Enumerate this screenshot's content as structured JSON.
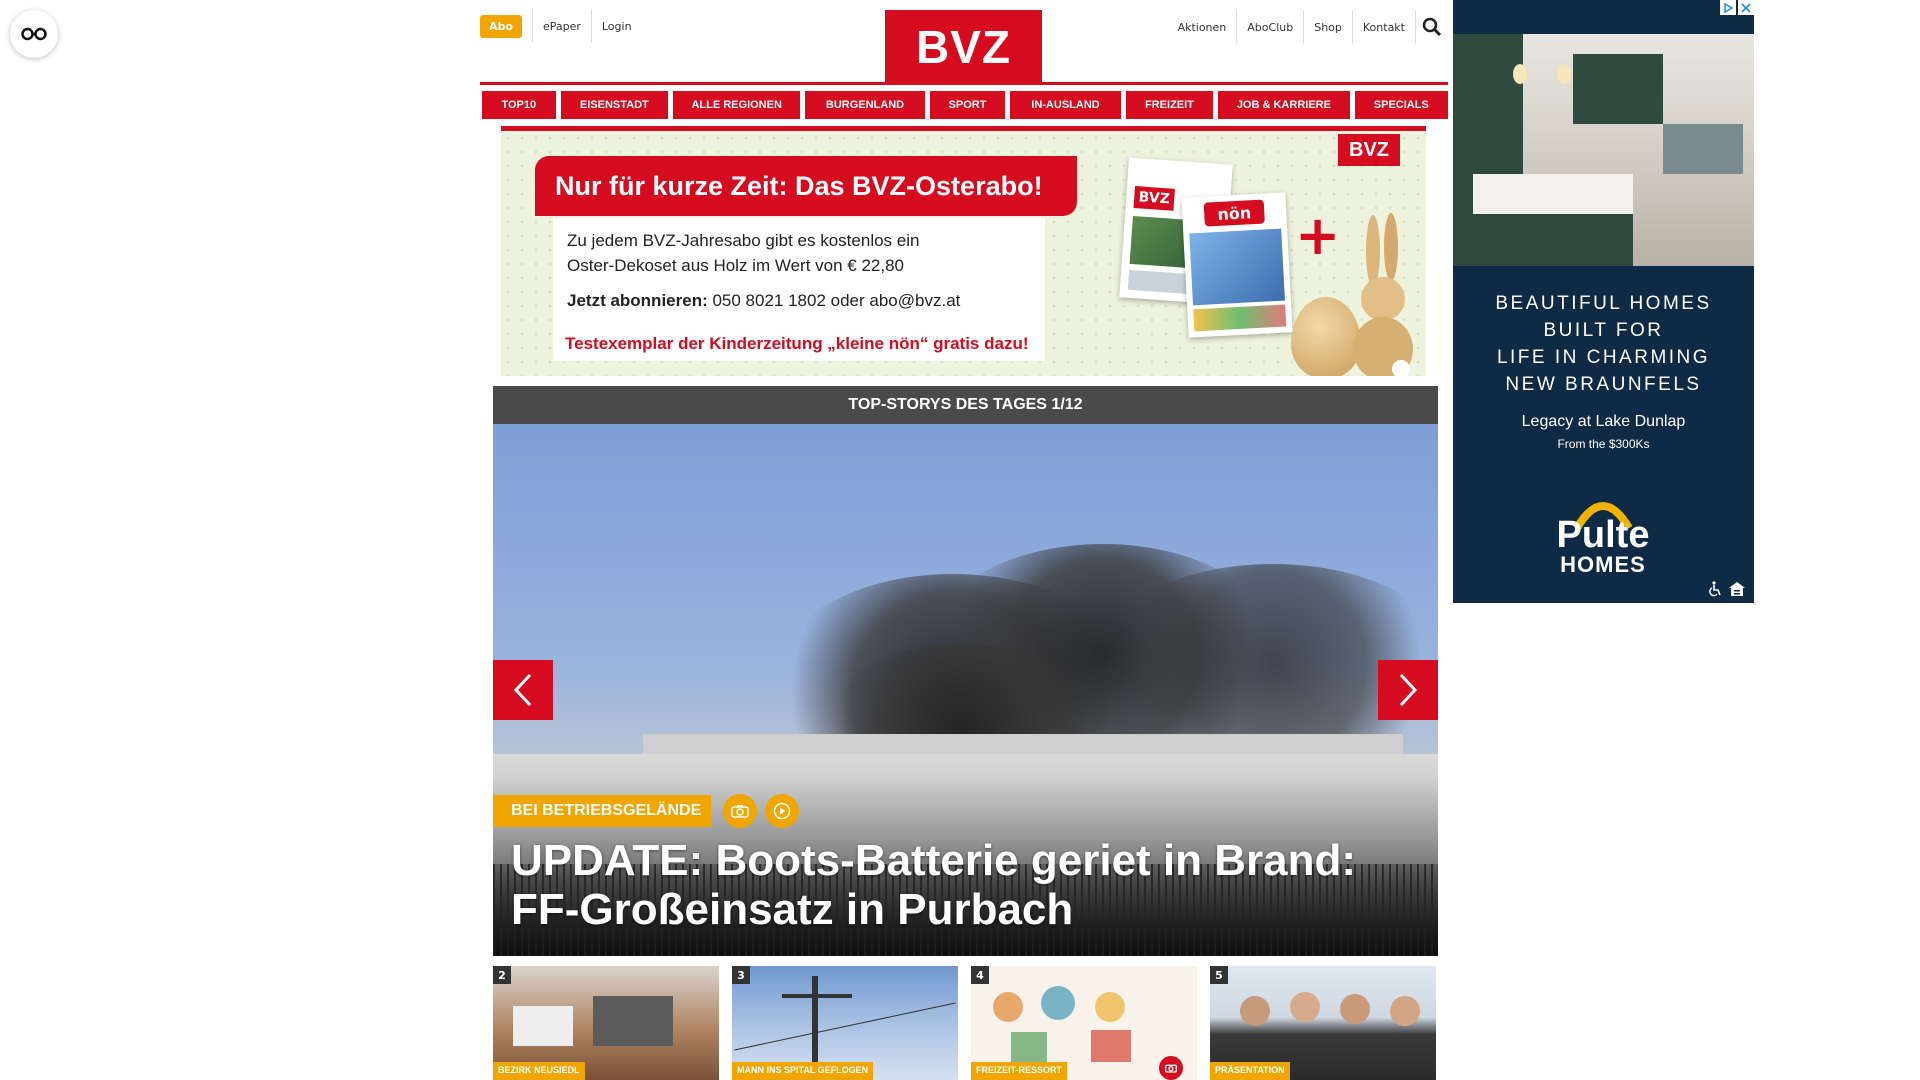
{
  "reader": {
    "icon": "glasses-icon"
  },
  "header": {
    "abo_label": "Abo",
    "left_links": [
      "ePaper",
      "Login"
    ],
    "logo_text": "BVZ",
    "right_links": [
      "Aktionen",
      "AboClub",
      "Shop",
      "Kontakt"
    ],
    "search_icon": "search-icon"
  },
  "nav": {
    "items": [
      "TOP10",
      "EISENSTADT",
      "ALLE REGIONEN",
      "BURGENLAND",
      "SPORT",
      "IN-AUSLAND",
      "FREIZEIT",
      "JOB & KARRIERE",
      "SPECIALS"
    ]
  },
  "promo": {
    "headline": "Nur für kurze Zeit: Das BVZ-Osterabo!",
    "line1": "Zu jedem BVZ-Jahresabo gibt es kostenlos ein",
    "line2": "Oster-Dekoset aus Holz im Wert von € 22,80",
    "cta_bold": "Jetzt abonnieren:",
    "cta_rest": " 050 8021 1802 oder abo@bvz.at",
    "footer": "Testexemplar der Kinderzeitung „kleine nön“ gratis dazu!",
    "badge": "BVZ",
    "paper_logo": "BVZ",
    "kids_logo": "nön",
    "plus": "+"
  },
  "stories": {
    "bar_title": "TOP-STORYS DES TAGES 1/12",
    "hero_kicker": "BEI BETRIEBSGELÄNDE",
    "hero_title_line1": "UPDATE: Boots-Batterie geriet in Brand:",
    "hero_title_line2": "FF-Großeinsatz in Purbach",
    "thumbs": [
      {
        "num": "2",
        "tag": "BEZIRK NEUSIEDL"
      },
      {
        "num": "3",
        "tag": "MANN INS SPITAL GEFLOGEN"
      },
      {
        "num": "4",
        "tag": "FREIZEIT-RESSORT"
      },
      {
        "num": "5",
        "tag": "PRÄSENTATION"
      }
    ]
  },
  "ad": {
    "headline_lines": [
      "BEAUTIFUL HOMES",
      "BUILT FOR",
      "LIFE IN CHARMING",
      "NEW BRAUNFELS"
    ],
    "sub1": "Legacy at Lake Dunlap",
    "sub2": "From the $300Ks",
    "brand_top": "Pulte",
    "brand_bottom": "HOMES",
    "colors": {
      "bg": "#0e2a44"
    }
  },
  "colors": {
    "brand_red": "#d50b1f",
    "accent": "#f0a500",
    "bar": "#4a4a4a"
  }
}
